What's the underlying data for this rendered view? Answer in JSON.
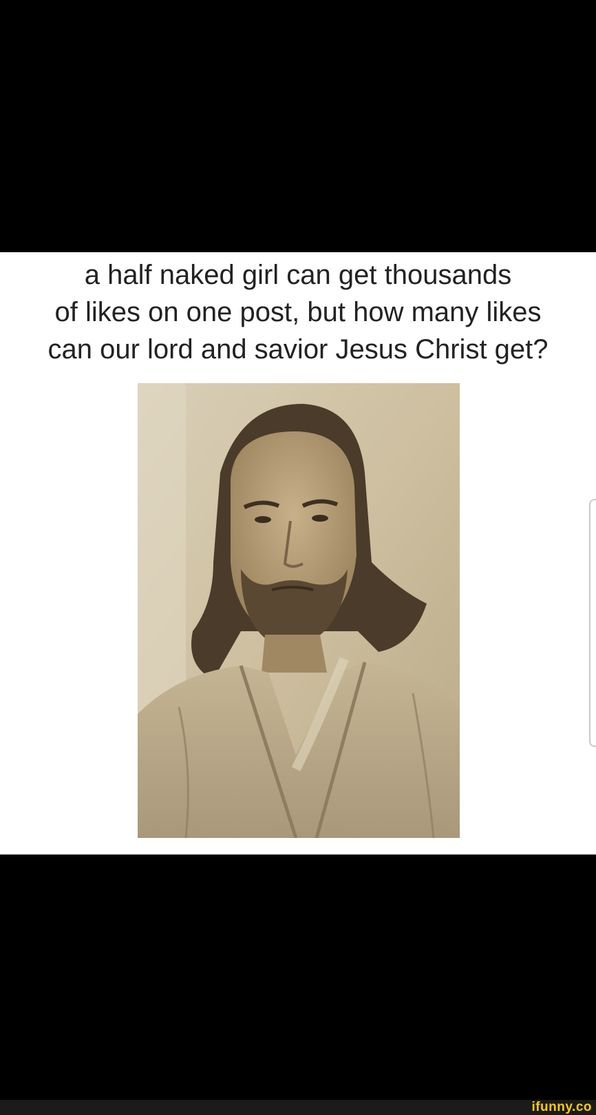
{
  "meme": {
    "caption_lines": [
      "a half naked girl can get thousands",
      "of likes on one post, but how many likes",
      "can our lord and savior Jesus Christ get?"
    ],
    "photo": {
      "subject": "sepia portrait of a bearded man with long hair in robes",
      "tone": "sepia"
    }
  },
  "footer": {
    "brand": "ifunny.co"
  },
  "colors": {
    "background": "#000000",
    "panel": "#ffffff",
    "brand": "#ffcc00",
    "footer_bar": "#1b1b1b"
  }
}
